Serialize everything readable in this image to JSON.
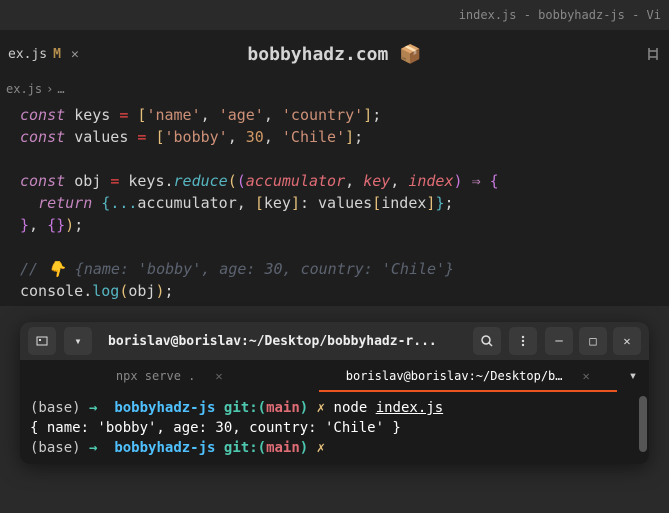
{
  "window_title": "index.js - bobbyhadz-js - Vi",
  "tab": {
    "name": "ex.js",
    "modified": "M"
  },
  "watermark": "bobbyhadz.com 📦",
  "breadcrumb": {
    "file": "ex.js",
    "sep": "›",
    "more": "…"
  },
  "code": {
    "l1": {
      "kw": "const",
      "var": "keys",
      "eq": "=",
      "lb": "[",
      "s1": "'name'",
      "c": ",",
      "s2": "'age'",
      "s3": "'country'",
      "rb": "]",
      "semi": ";"
    },
    "l2": {
      "kw": "const",
      "var": "values",
      "eq": "=",
      "lb": "[",
      "s1": "'bobby'",
      "c": ",",
      "n": "30",
      "s3": "'Chile'",
      "rb": "]",
      "semi": ";"
    },
    "l3": {
      "kw": "const",
      "var": "obj",
      "eq": "=",
      "keys": "keys",
      "dot": ".",
      "fn": "reduce",
      "lp": "(",
      "lp2": "(",
      "p1": "accumulator",
      "c": ",",
      "p2": "key",
      "p3": "index",
      "rp": ")",
      "arrow": "⇒",
      "lb": "{"
    },
    "l4": {
      "kw": "return",
      "lb": "{",
      "spread": "...",
      "acc": "accumulator",
      "c": ",",
      "lbr": "[",
      "key": "key",
      "rbr": "]",
      "col": ":",
      "vals": "values",
      "lbr2": "[",
      "idx": "index",
      "rbr2": "]",
      "rb": "}",
      "semi": ";"
    },
    "l5": {
      "rb": "}",
      "c": ",",
      "lb": "{",
      "rb2": "}",
      "rp": ")",
      "semi": ";"
    },
    "l6": {
      "cmt": "// 👇 {name: 'bobby', age: 30, country: 'Chile'}"
    },
    "l7": {
      "cons": "console",
      "dot": ".",
      "log": "log",
      "lp": "(",
      "obj": "obj",
      "rp": ")",
      "semi": ";"
    }
  },
  "terminal": {
    "title": "borislav@borislav:~/Desktop/bobbyhadz-r...",
    "tabs": {
      "t1": "npx serve .",
      "t2": "borislav@borislav:~/Desktop/b…"
    },
    "lines": {
      "l1": {
        "base": "(base)",
        "arrow": "→",
        "dir": "bobbyhadz-js",
        "git": "git:(",
        "branch": "main",
        "gitc": ")",
        "x": "✗",
        "cmd": "node",
        "file": "index.js"
      },
      "l2": "{ name: 'bobby', age: 30, country: 'Chile' }",
      "l3": {
        "base": "(base)",
        "arrow": "→",
        "dir": "bobbyhadz-js",
        "git": "git:(",
        "branch": "main",
        "gitc": ")",
        "x": "✗"
      }
    }
  }
}
